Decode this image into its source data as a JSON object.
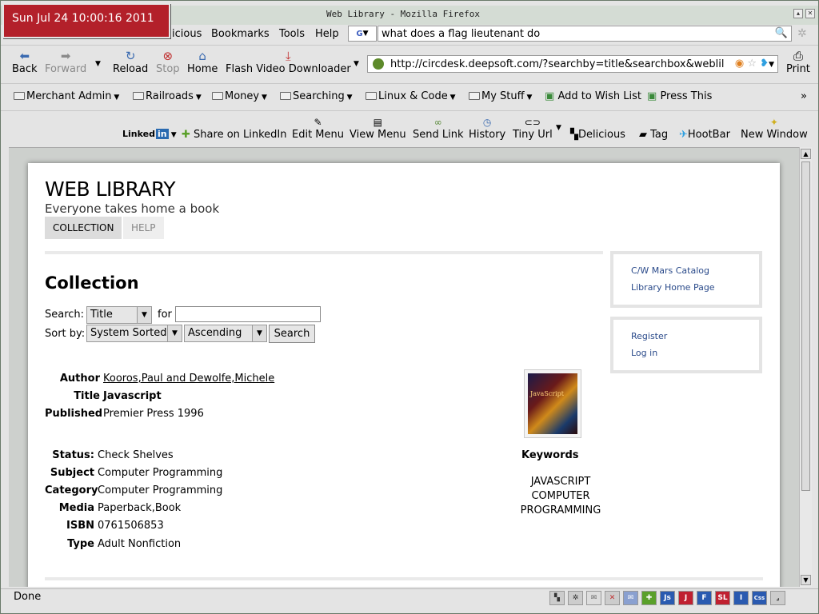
{
  "window": {
    "title": "Web Library - Mozilla Firefox",
    "clock": "Sun Jul 24 10:00:16 2011"
  },
  "menu": {
    "partial": "icious",
    "bookmarks": "Bookmarks",
    "tools": "Tools",
    "help": "Help"
  },
  "search": {
    "value": "what does a flag lieutenant do"
  },
  "nav": {
    "back": "Back",
    "forward": "Forward",
    "reload": "Reload",
    "stop": "Stop",
    "home": "Home",
    "flash": "Flash Video Downloader",
    "print": "Print",
    "url": "http://circdesk.deepsoft.com/?searchby=title&searchbox&weblil"
  },
  "bookmarks": [
    "Merchant Admin",
    "Railroads",
    "Money",
    "Searching",
    "Linux & Code",
    "My Stuff"
  ],
  "bookmark_links": [
    "Add to Wish List",
    "Press This"
  ],
  "linked": {
    "brand": "Linked",
    "brand_in": "in",
    "share": "Share on LinkedIn",
    "edit_menu": "Edit Menu",
    "view_menu": "View Menu",
    "send_link": "Send Link",
    "history": "History",
    "tiny_url": "Tiny Url",
    "delicious": "Delicious",
    "tag": "Tag",
    "hootbar": "HootBar",
    "new_window": "New Window"
  },
  "site": {
    "title": "WEB LIBRARY",
    "tagline": "Everyone takes home a book",
    "tabs": [
      "COLLECTION",
      "HELP"
    ]
  },
  "collection": {
    "heading": "Collection",
    "search_label": "Search:",
    "search_by": "Title",
    "for_label": "for",
    "sort_label": "Sort by:",
    "sort_by": "System Sorted",
    "order": "Ascending",
    "search_button": "Search"
  },
  "record": {
    "author_label": "Author",
    "author": "Kooros,Paul and Dewolfe,Michele",
    "title_label": "Title",
    "title": "Javascript",
    "published_label": "Published",
    "published": "Premier Press 1996",
    "status_label": "Status:",
    "status": "Check Shelves",
    "subject_label": "Subject",
    "subject": "Computer Programming",
    "category_label": "Category",
    "category": "Computer Programming",
    "media_label": "Media",
    "media": "Paperback,Book",
    "isbn_label": "ISBN",
    "isbn": "0761506853",
    "type_label": "Type",
    "type": "Adult Nonfiction",
    "cover_text": "JavaScript",
    "keywords_label": "Keywords",
    "keywords": [
      "JAVASCRIPT",
      "COMPUTER",
      "PROGRAMMING"
    ]
  },
  "sidebar": {
    "links1": [
      "C/W Mars Catalog",
      "Library Home Page"
    ],
    "links2": [
      "Register",
      "Log in"
    ]
  },
  "status": {
    "text": "Done",
    "icons": [
      "Js",
      "J",
      "F",
      "SL",
      "I",
      "Css"
    ]
  }
}
